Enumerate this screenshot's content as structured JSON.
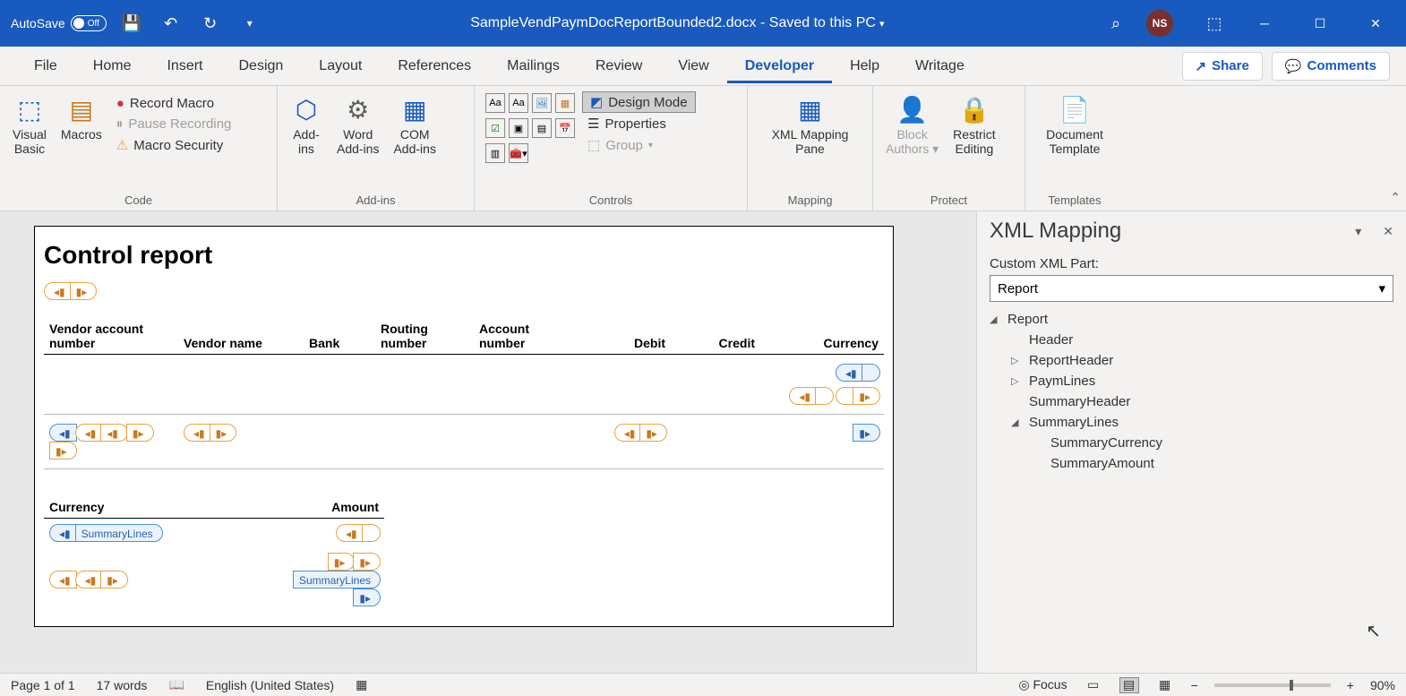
{
  "titlebar": {
    "autosave_label": "AutoSave",
    "autosave_state": "Off",
    "doc_title": "SampleVendPaymDocReportBounded2.docx - Saved to this PC",
    "user_initials": "NS"
  },
  "tabs": {
    "file": "File",
    "home": "Home",
    "insert": "Insert",
    "design": "Design",
    "layout": "Layout",
    "references": "References",
    "mailings": "Mailings",
    "review": "Review",
    "view": "View",
    "developer": "Developer",
    "help": "Help",
    "writage": "Writage",
    "share": "Share",
    "comments": "Comments"
  },
  "ribbon": {
    "code": {
      "visual_basic": "Visual\nBasic",
      "macros": "Macros",
      "record_macro": "Record Macro",
      "pause_recording": "Pause Recording",
      "macro_security": "Macro Security",
      "group": "Code"
    },
    "addins": {
      "addins": "Add-\nins",
      "word_addins": "Word\nAdd-ins",
      "com_addins": "COM\nAdd-ins",
      "group": "Add-ins"
    },
    "controls": {
      "design_mode": "Design Mode",
      "properties": "Properties",
      "group_btn": "Group",
      "group": "Controls"
    },
    "mapping": {
      "xml_mapping_pane": "XML Mapping\nPane",
      "group": "Mapping"
    },
    "protect": {
      "block_authors": "Block\nAuthors",
      "restrict_editing": "Restrict\nEditing",
      "group": "Protect"
    },
    "templates": {
      "document_template": "Document\nTemplate",
      "group": "Templates"
    }
  },
  "document": {
    "title": "Control report",
    "table_headers": {
      "vendor_account": "Vendor account number",
      "vendor_name": "Vendor name",
      "bank": "Bank",
      "routing": "Routing number",
      "account": "Account number",
      "debit": "Debit",
      "credit": "Credit",
      "currency": "Currency"
    },
    "summary_headers": {
      "currency": "Currency",
      "amount": "Amount"
    },
    "summary_lines_tag": "SummaryLines"
  },
  "pane": {
    "title": "XML Mapping",
    "label": "Custom XML Part:",
    "selected": "Report",
    "tree": {
      "report": "Report",
      "header": "Header",
      "report_header": "ReportHeader",
      "paym_lines": "PaymLines",
      "summary_header": "SummaryHeader",
      "summary_lines": "SummaryLines",
      "summary_currency": "SummaryCurrency",
      "summary_amount": "SummaryAmount"
    }
  },
  "status": {
    "page": "Page 1 of 1",
    "words": "17 words",
    "language": "English (United States)",
    "focus": "Focus",
    "zoom": "90%"
  }
}
